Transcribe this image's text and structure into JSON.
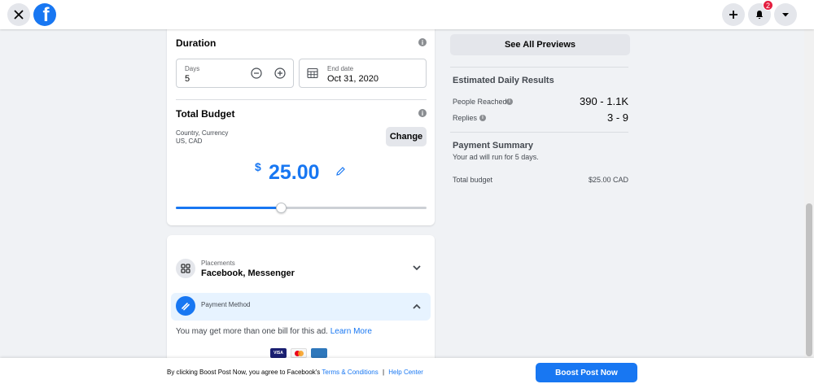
{
  "topbar": {
    "close_icon": "close-icon",
    "logo_letter": "f",
    "notification_count": "2"
  },
  "duration": {
    "title": "Duration",
    "days_label": "Days",
    "days_value": "5",
    "end_date_label": "End date",
    "end_date_value": "Oct 31, 2020"
  },
  "budget": {
    "title": "Total Budget",
    "country_currency_label": "Country, Currency",
    "country_currency_value": "US, CAD",
    "change_label": "Change",
    "currency_symbol": "$",
    "amount": "25.00",
    "slider_fraction": 0.42
  },
  "placements": {
    "label": "Placements",
    "value": "Facebook, Messenger"
  },
  "payment_method": {
    "label": "Payment Method",
    "note": "You may get more than one bill for this ad.",
    "learn_more": "Learn More",
    "cards": [
      "VISA",
      "mastercard",
      "amex"
    ]
  },
  "preview": {
    "see_all_label": "See All Previews"
  },
  "results": {
    "title": "Estimated Daily Results",
    "people_reached_label": "People Reached",
    "people_reached_value": "390 - 1.1K",
    "replies_label": "Replies",
    "replies_value": "3 - 9"
  },
  "payment_summary": {
    "title": "Payment Summary",
    "subtitle": "Your ad will run for 5 days.",
    "total_label": "Total budget",
    "total_value": "$25.00 CAD"
  },
  "footer": {
    "agree_text": "By clicking Boost Post Now, you agree to Facebook's",
    "terms_link": "Terms & Conditions",
    "separator": "|",
    "help_link": "Help Center",
    "boost_button": "Boost Post Now"
  },
  "colors": {
    "accent": "#1877f2",
    "background": "#f0f2f5"
  }
}
